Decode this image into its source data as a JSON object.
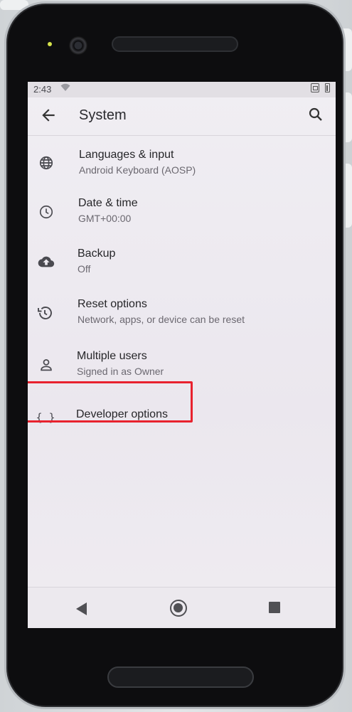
{
  "status_bar": {
    "time": "2:43",
    "icons": [
      "wifi-icon",
      "sim-card-icon",
      "battery-icon"
    ]
  },
  "app_bar": {
    "title": "System",
    "back_icon": "arrow-back-icon",
    "search_icon": "search-icon"
  },
  "settings": [
    {
      "title": "Languages & input",
      "subtitle": "Android Keyboard (AOSP)",
      "icon": "globe-icon"
    },
    {
      "title": "Date & time",
      "subtitle": "GMT+00:00",
      "icon": "clock-icon"
    },
    {
      "title": "Backup",
      "subtitle": "Off",
      "icon": "cloud-upload-icon"
    },
    {
      "title": "Reset options",
      "subtitle": "Network, apps, or device can be reset",
      "icon": "history-icon"
    },
    {
      "title": "Multiple users",
      "subtitle": "Signed in as Owner",
      "icon": "person-icon"
    },
    {
      "title": "Developer options",
      "icon": "braces-icon",
      "icon_glyph": "{ }",
      "highlighted": true
    }
  ],
  "nav_bar": {
    "buttons": [
      "nav-back-icon",
      "nav-home-icon",
      "nav-recents-icon"
    ]
  },
  "colors": {
    "highlight": "#e8222e",
    "screen_bg": "#ece9ee",
    "text_primary": "#262629",
    "text_secondary": "#6b6870"
  }
}
